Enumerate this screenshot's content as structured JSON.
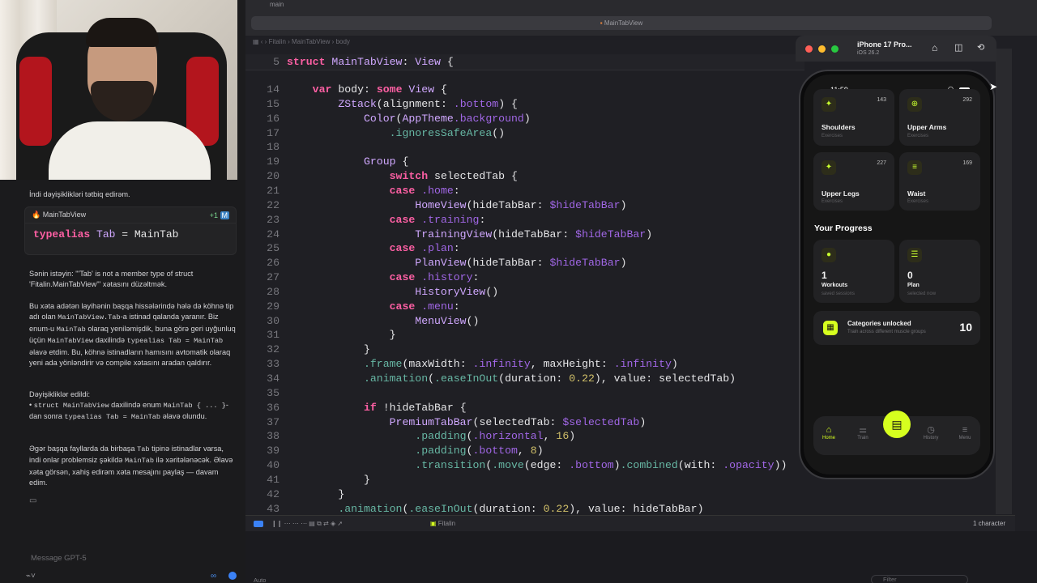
{
  "webcam": {
    "label": "webcam"
  },
  "chat": {
    "intro": "İndi dəyişiklikləri tətbiq edirəm.",
    "snippet_file": "MainTabView",
    "snippet_badge": "+1",
    "snippet_code_kw": "typealias",
    "snippet_code_ty": "Tab",
    "snippet_code_rest": " = MainTab",
    "p1": "Sənin istəyin: \"'Tab' is not a member type of struct 'Fitalin.MainTabView'\" xətasını düzəltmək.",
    "p2a": "Bu xəta adətən layihənin başqa hissələrində hələ də köhnə tip adı olan ",
    "p2b": "MainTabView.Tab",
    "p2c": "-a istinad qalanda yaranır. Biz enum-u ",
    "p2d": "MainTab",
    "p2e": " olaraq yeniləmişdik, buna görə geri uyğunluq üçün ",
    "p2f": "MainTabView",
    "p2g": " daxilində ",
    "p2h": "typealias Tab = MainTab",
    "p2i": " əlavə etdim. Bu, köhnə istinadların hamısını avtomatik olaraq yeni ada yönləndirir və compile xətasını aradan qaldırır.",
    "changes_title": "Dəyişikliklər edildi:",
    "c1a": "• ",
    "c1b": "struct MainTabView",
    "c1c": " daxilində enum ",
    "c1d": "MainTab { ... }",
    "c1e": "-dan sonra ",
    "c1f": "typealias Tab = MainTab",
    "c1g": " əlavə olundu.",
    "p3a": "Əgər başqa fayllarda da birbaşa ",
    "p3b": "Tab",
    "p3c": " tipinə istinadlar varsa, indi onlar problemsiz şəkildə ",
    "p3d": "MainTab",
    "p3e": " ilə xəritələnəcək. Əlavə xəta görsən, xahiş edirəm xəta mesajını paylaş — davam edim.",
    "message_placeholder": "Message GPT-5"
  },
  "editor": {
    "branch": "main",
    "tab_title": "MainTabView",
    "breadcrumb": [
      "Fitalin",
      "MainTabView",
      "body"
    ],
    "sticky": {
      "num": "5",
      "text": "struct MainTabView: View {"
    },
    "status_right": "1 character",
    "scheme": "Fitalin",
    "console_left": "Auto",
    "filter_placeholder": "Filter"
  },
  "code": [
    {
      "n": "14",
      "t": "    var body: some View {"
    },
    {
      "n": "15",
      "t": "        ZStack(alignment: .bottom) {"
    },
    {
      "n": "16",
      "t": "            Color(AppTheme.background)"
    },
    {
      "n": "17",
      "t": "                .ignoresSafeArea()"
    },
    {
      "n": "18",
      "t": ""
    },
    {
      "n": "19",
      "t": "            Group {"
    },
    {
      "n": "20",
      "t": "                switch selectedTab {"
    },
    {
      "n": "21",
      "t": "                case .home:"
    },
    {
      "n": "22",
      "t": "                    HomeView(hideTabBar: $hideTabBar)"
    },
    {
      "n": "23",
      "t": "                case .training:"
    },
    {
      "n": "24",
      "t": "                    TrainingView(hideTabBar: $hideTabBar)"
    },
    {
      "n": "25",
      "t": "                case .plan:"
    },
    {
      "n": "26",
      "t": "                    PlanView(hideTabBar: $hideTabBar)"
    },
    {
      "n": "27",
      "t": "                case .history:"
    },
    {
      "n": "28",
      "t": "                    HistoryView()"
    },
    {
      "n": "29",
      "t": "                case .menu:"
    },
    {
      "n": "30",
      "t": "                    MenuView()"
    },
    {
      "n": "31",
      "t": "                }"
    },
    {
      "n": "32",
      "t": "            }"
    },
    {
      "n": "33",
      "t": "            .frame(maxWidth: .infinity, maxHeight: .infinity)"
    },
    {
      "n": "34",
      "t": "            .animation(.easeInOut(duration: 0.22), value: selectedTab)"
    },
    {
      "n": "35",
      "t": ""
    },
    {
      "n": "36",
      "t": "            if !hideTabBar {"
    },
    {
      "n": "37",
      "t": "                PremiumTabBar(selectedTab: $selectedTab)"
    },
    {
      "n": "38",
      "t": "                    .padding(.horizontal, 16)"
    },
    {
      "n": "39",
      "t": "                    .padding(.bottom, 8)"
    },
    {
      "n": "40",
      "t": "                    .transition(.move(edge: .bottom).combined(with: .opacity))"
    },
    {
      "n": "41",
      "t": "            }"
    },
    {
      "n": "42",
      "t": "        }"
    },
    {
      "n": "43",
      "t": "        .animation(.easeInOut(duration: 0.22), value: hideTabBar)"
    }
  ],
  "simulator": {
    "device": "iPhone 17 Pro...",
    "os": "iOS 26.2",
    "time": "11:59",
    "cards": [
      {
        "name": "Shoulders",
        "sub": "Exercises",
        "count": "143",
        "icon": "✦"
      },
      {
        "name": "Upper Arms",
        "sub": "Exercises",
        "count": "292",
        "icon": "⊕"
      },
      {
        "name": "Upper Legs",
        "sub": "Exercises",
        "count": "227",
        "icon": "✦"
      },
      {
        "name": "Waist",
        "sub": "Exercises",
        "count": "169",
        "icon": "≡"
      }
    ],
    "progress_title": "Your Progress",
    "workouts": {
      "value": "1",
      "label": "Workouts",
      "sub": "saved sessions"
    },
    "plan": {
      "value": "0",
      "label": "Plan",
      "sub": "selected now"
    },
    "categories": {
      "title": "Categories unlocked",
      "sub": "Train across different muscle groups",
      "value": "10"
    },
    "tabs": [
      "Home",
      "Train",
      "",
      "History",
      "Menu"
    ]
  },
  "colors": {
    "accent": "#d6ff1f",
    "keyword": "#fc5fa3",
    "type": "#d0a8ff"
  }
}
